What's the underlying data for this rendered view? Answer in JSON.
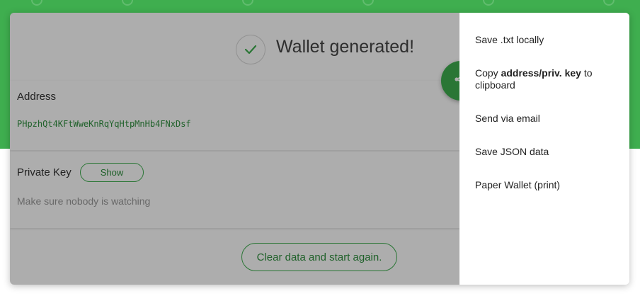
{
  "header": {
    "title": "Wallet generated!"
  },
  "address": {
    "label": "Address",
    "value": "PHpzhQt4KFtWweKnRqYqHtpMnHb4FNxDsf"
  },
  "private_key": {
    "label": "Private Key",
    "show_label": "Show",
    "hint": "Make sure nobody is watching"
  },
  "actions": {
    "clear_label": "Clear data and start again."
  },
  "menu": {
    "save_txt": "Save .txt locally",
    "copy_prefix": "Copy ",
    "copy_bold": "address/priv. key",
    "copy_suffix": " to clipboard",
    "send_email": "Send via email",
    "save_json": "Save JSON data",
    "paper_wallet": "Paper Wallet (print)"
  },
  "icons": {
    "success": "check-icon",
    "share": "share-icon"
  },
  "colors": {
    "brand_green": "#3fae4f",
    "accent_text_green": "#2f8f3e",
    "overlay": "rgba(0,0,0,0.32)"
  }
}
